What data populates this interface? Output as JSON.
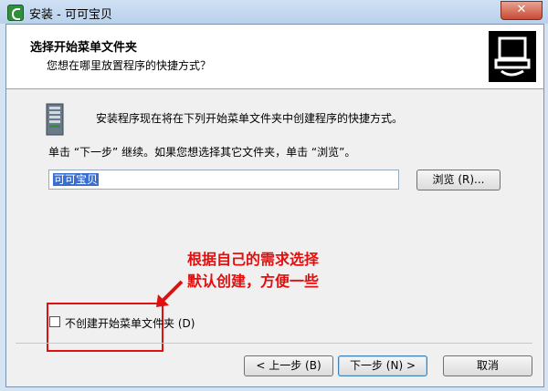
{
  "window": {
    "title": "安装 - 可可宝贝",
    "close_label": "✕"
  },
  "header": {
    "title": "选择开始菜单文件夹",
    "subtitle": "您想在哪里放置程序的快捷方式？"
  },
  "body": {
    "intro": "安装程序现在将在下列开始菜单文件夹中创建程序的快捷方式。",
    "instruction": "单击 “下一步” 继续。如果您想选择其它文件夹，单击 “浏览”。",
    "folder_value": "可可宝贝",
    "browse_label": "浏览 (R)...",
    "checkbox_label": "不创建开始菜单文件夹 (D)",
    "checkbox_checked": false
  },
  "annotation": {
    "line1": "根据自己的需求选择",
    "line2": "默认创建，方便一些",
    "color": "#e01010"
  },
  "footer": {
    "back_label": "< 上一步 (B)",
    "next_label": "下一步 (N) >",
    "cancel_label": "取消"
  },
  "icons": {
    "app": "installer-app-icon",
    "header": "computer-install-icon",
    "folder": "start-menu-folder-icon",
    "arrow": "red-annotation-arrow"
  }
}
